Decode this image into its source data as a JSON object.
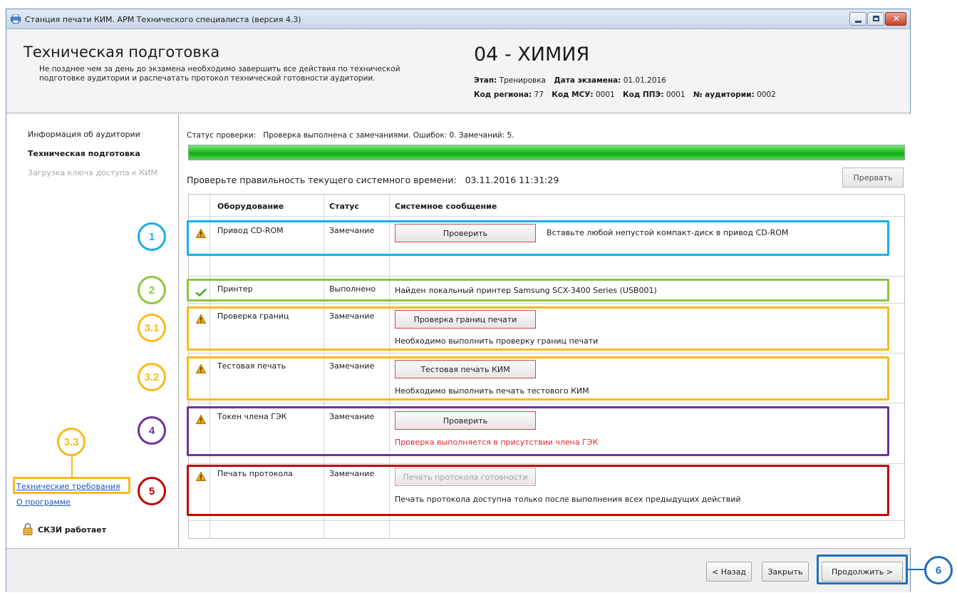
{
  "window": {
    "title": "Станция печати КИМ. АРМ Технического специалиста (версия 4.3)"
  },
  "header": {
    "title": "Техническая подготовка",
    "description": "Не позднее чем за день до экзамена необходимо завершить все действия по технической подготовке аудитории и распечатать протокол технической готовности аудитории.",
    "subject": "04 - ХИМИЯ",
    "stage_label": "Этап:",
    "stage_value": "Тренировка",
    "exam_date_label": "Дата экзамена:",
    "exam_date_value": "01.01.2016",
    "region_label": "Код региона:",
    "region_value": "77",
    "msu_label": "Код МСУ:",
    "msu_value": "0001",
    "ppe_label": "Код ППЭ:",
    "ppe_value": "0001",
    "room_label": "№ аудитории:",
    "room_value": "0002"
  },
  "sidebar": {
    "items": [
      {
        "label": "Информация об аудитории",
        "state": "normal"
      },
      {
        "label": "Техническая подготовка",
        "state": "active"
      },
      {
        "label": "Загрузка ключа доступа к КИМ",
        "state": "disabled"
      }
    ],
    "tech_req_link": "Технические требования",
    "about_link": "О программе",
    "skzi_status": "СКЗИ работает"
  },
  "main": {
    "status_label": "Статус проверки:",
    "status_text": "Проверка выполнена с замечаниями. Ошибок: 0. Замечаний: 5.",
    "progress": 1.0,
    "time_label": "Проверьте правильность текущего системного времени:",
    "time_value": "03.11.2016 11:31:29",
    "abort_button": "Прервать",
    "columns": [
      "Оборудование",
      "Статус",
      "Системное сообщение"
    ],
    "rows": [
      {
        "equipment": "Привод CD-ROM",
        "status": "Замечание",
        "button": "Проверить",
        "message": "Вставьте любой непустой компакт-диск в привод CD-ROM"
      },
      {
        "equipment": "Принтер",
        "status": "Выполнено",
        "message": "Найден локальный принтер Samsung SCX-3400 Series (USB001)"
      },
      {
        "equipment": "Проверка границ",
        "status": "Замечание",
        "button": "Проверка границ печати",
        "message": "Необходимо выполнить проверку границ печати"
      },
      {
        "equipment": "Тестовая печать",
        "status": "Замечание",
        "button": "Тестовая печать КИМ",
        "message": "Необходимо выполнить печать тестового КИМ"
      },
      {
        "equipment": "Токен члена ГЭК",
        "status": "Замечание",
        "button": "Проверить",
        "message": "Проверка выполняется в присутствии члена ГЭК"
      },
      {
        "equipment": "Печать протокола",
        "status": "Замечание",
        "button": "Печать протокола готовности",
        "message": "Печать протокола доступна только после выполнения всех предыдущих действий"
      }
    ]
  },
  "footer": {
    "back_button": "< Назад",
    "close_button": "Закрыть",
    "continue_button": "Продолжить >"
  },
  "annotations": {
    "labels": [
      "1",
      "2",
      "3.1",
      "3.2",
      "3.3",
      "4",
      "5",
      "6"
    ],
    "colors": {
      "blue": "#1aaee8",
      "green": "#8cc63f",
      "yellow": "#f8bb1c",
      "purple": "#7030a0",
      "red": "#c00000",
      "navy": "#1f6fbf"
    }
  },
  "theme": {
    "progress_green": "#1fbd1f",
    "link_blue": "#1a56c8",
    "alert_red": "#e0262b",
    "warning_amber": "#f0a800"
  }
}
